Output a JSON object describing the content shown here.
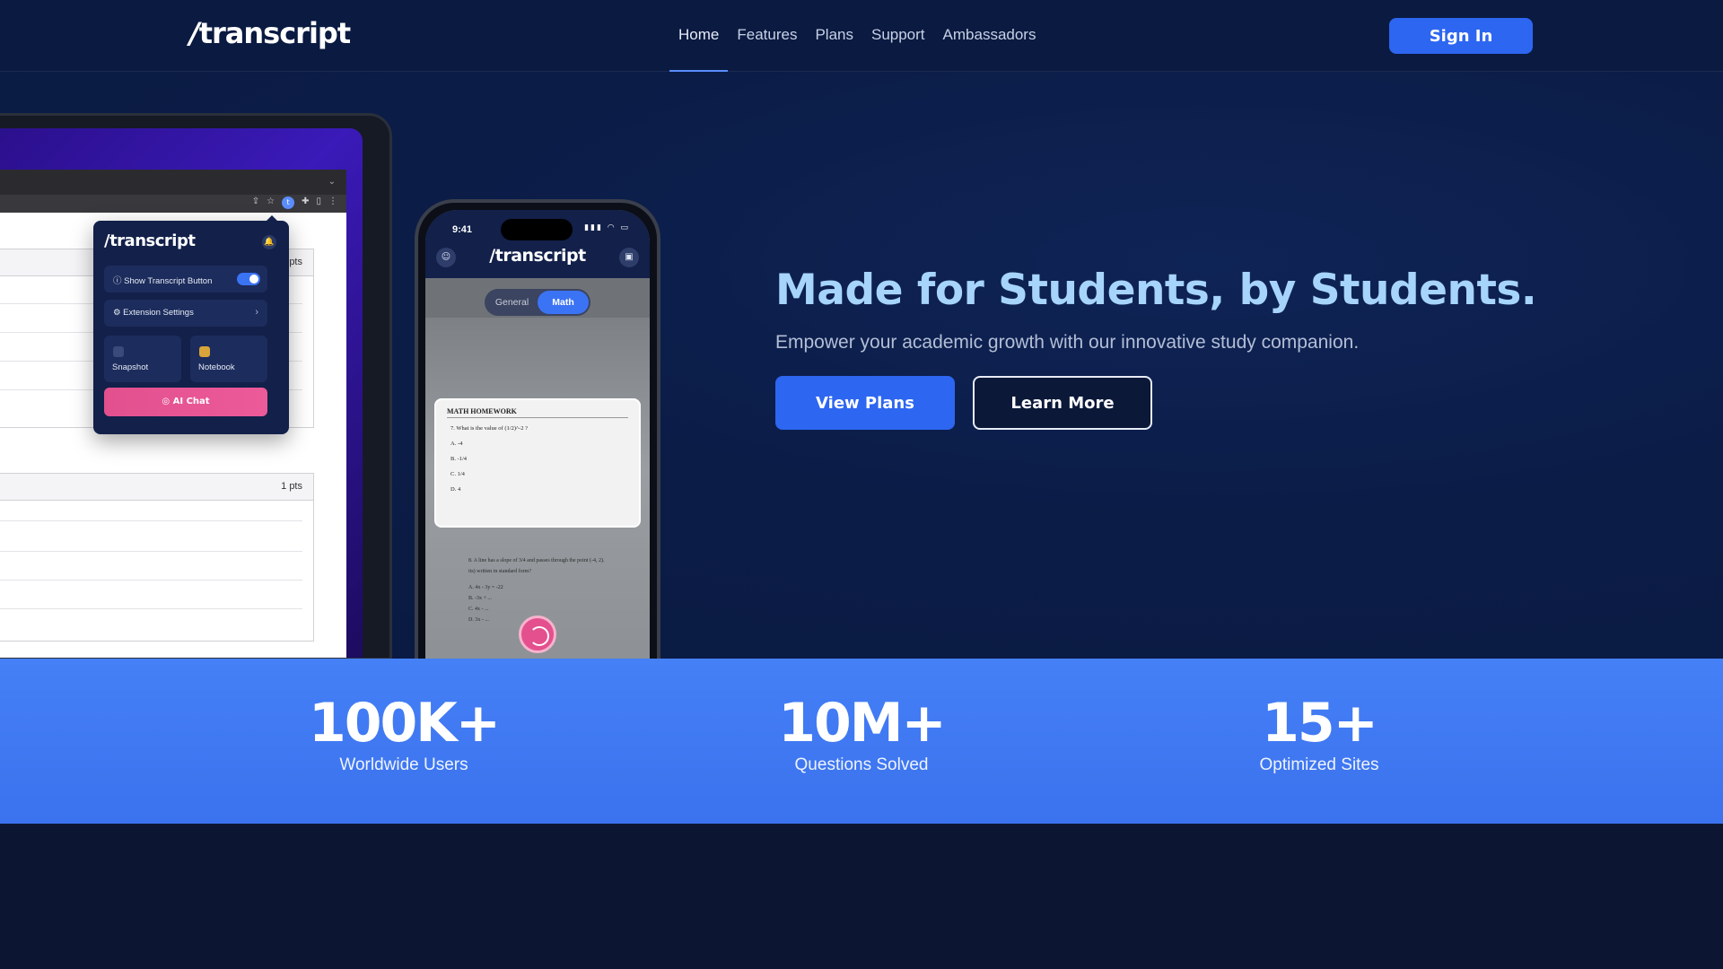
{
  "header": {
    "logo": "transcript",
    "logo_prefix": "/",
    "nav": [
      {
        "label": "Home"
      },
      {
        "label": "Features"
      },
      {
        "label": "Plans"
      },
      {
        "label": "Support"
      },
      {
        "label": "Ambassadors"
      }
    ],
    "active_nav": "Home",
    "sign_in_label": "Sign In"
  },
  "laptop": {
    "question_points": [
      "pts",
      "1 pts"
    ],
    "extension_popup": {
      "logo": "/transcript",
      "show_button_label": "Show Transcript Button",
      "show_button_enabled": true,
      "settings_label": "Extension Settings",
      "tiles": [
        {
          "label": "Snapshot",
          "icon": "snapshot-icon"
        },
        {
          "label": "Notebook",
          "icon": "notebook-icon"
        }
      ],
      "ai_chat_label": "AI Chat"
    }
  },
  "phone": {
    "time": "9:41",
    "logo": "/transcript",
    "tabs": [
      {
        "label": "General"
      },
      {
        "label": "Math"
      }
    ],
    "active_tab": "Math",
    "scan": {
      "title": "MATH HOMEWORK",
      "lines": [
        "7.  What is the value of (1/2)^-2 ?",
        "A.  -4",
        "B.  -1/4",
        "C.  1/4",
        "D.  4"
      ],
      "below_lines": [
        "8.  A line has a slope of 3/4 and passes through the point (-4, 2).",
        "its) written in standard form?",
        "A.  4x - 3y = -22",
        "B.  -3x + ...",
        "C.  4x - ...",
        "D.  3x - ..."
      ]
    }
  },
  "hero": {
    "title": "Made for Students, by Students.",
    "subtitle": "Empower your academic growth with our innovative study companion.",
    "primary_label": "View Plans",
    "secondary_label": "Learn More"
  },
  "stats": [
    {
      "value": "100K+",
      "label": "Worldwide Users"
    },
    {
      "value": "10M+",
      "label": "Questions Solved"
    },
    {
      "value": "15+",
      "label": "Optimized Sites"
    }
  ],
  "colors": {
    "background": "#0a1a41",
    "accent": "#2d66f0",
    "headline": "#a6d4fb",
    "stats_band": "#4580f6",
    "ai_chat": "#e2508e"
  }
}
